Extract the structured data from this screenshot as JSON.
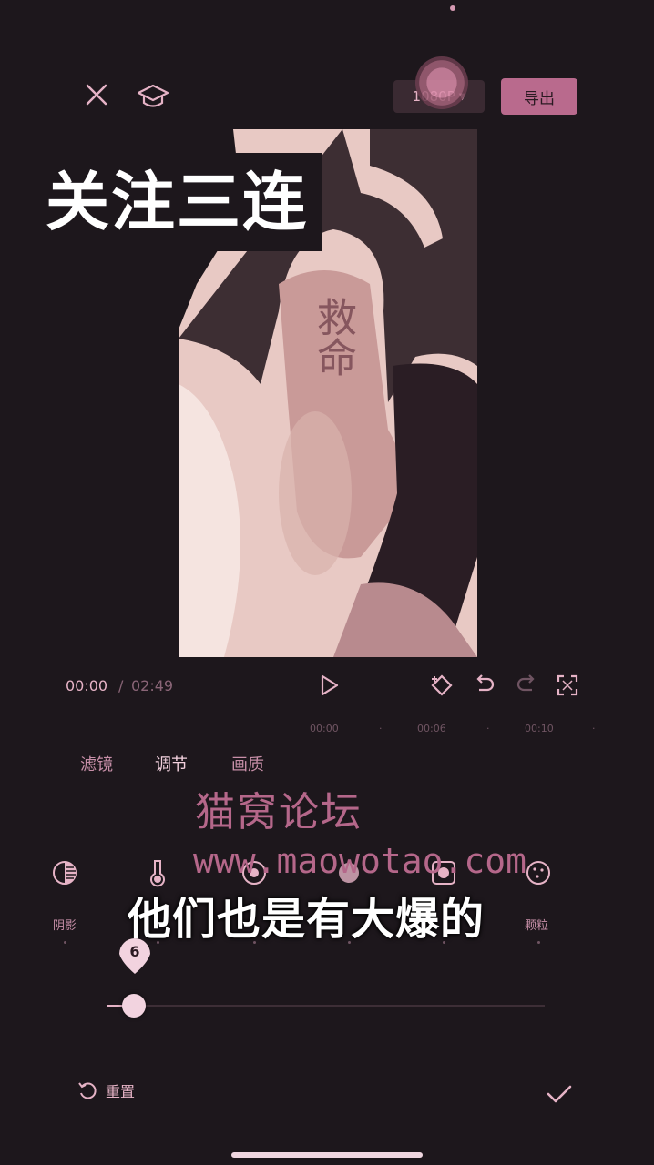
{
  "top_bar": {
    "resolution": "1080P",
    "export_label": "导出"
  },
  "overlay_title": "关注三连",
  "video_content": {
    "hand_text": "救命"
  },
  "transport": {
    "current_time": "00:00",
    "separator": "/",
    "total_time": "02:49",
    "ruler_marks": [
      "00:00",
      "00:06",
      "00:10"
    ]
  },
  "tabs": [
    {
      "label": "滤镜"
    },
    {
      "label": "调节"
    },
    {
      "label": "画质"
    }
  ],
  "watermark": {
    "forum": "猫窝论坛",
    "url": "www.maowotao.com"
  },
  "subtitle": "他们也是有大爆的",
  "tools": [
    {
      "label": "阴影",
      "icon": "shadow-icon"
    },
    {
      "label": "",
      "icon": "temperature-icon"
    },
    {
      "label": "",
      "icon": "hue-icon"
    },
    {
      "label": "",
      "icon": "fade-icon"
    },
    {
      "label": "",
      "icon": "vignette-icon"
    },
    {
      "label": "颗粒",
      "icon": "grain-icon"
    }
  ],
  "slider": {
    "value": "6"
  },
  "bottom": {
    "reset_label": "重置"
  },
  "colors": {
    "background": "#1d171c",
    "accent": "#b96a8d",
    "text": "#e6b3c6"
  }
}
